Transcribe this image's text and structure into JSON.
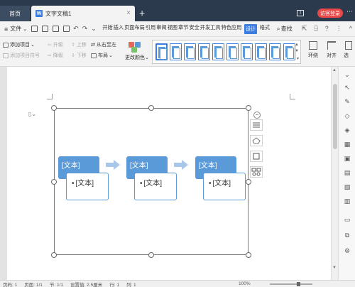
{
  "titlebar": {
    "home_tab": "首页",
    "doc_tab": "文字文稿1",
    "doc_icon": "W",
    "close": "×",
    "new_tab": "+",
    "window_badge": "1",
    "login_label": "访客登录"
  },
  "menubar": {
    "hamburger": "≡",
    "file": "文件",
    "file_arrow": "⌄",
    "items": [
      "开始",
      "插入",
      "页面布局",
      "引用",
      "审阅",
      "视图",
      "章节",
      "安全",
      "开发工具",
      "特色应用"
    ],
    "active_item": "设计",
    "format_item": "格式",
    "search_label": "查找",
    "right": [
      "⇱",
      "⍈",
      "?",
      "⋮",
      "^"
    ]
  },
  "ribbon": {
    "add_item": "添加项目",
    "promote": "升级",
    "move_up": "上移",
    "right_to_left": "从右至左",
    "add_bullet": "添加项目符号",
    "demote": "降级",
    "move_down": "下移",
    "layout": "布局",
    "change_color": "更改颜色",
    "wrap": "环绕",
    "align": "对齐",
    "select": "选"
  },
  "colors": {
    "accent": "#3b7de0",
    "node": "#5b9ad8",
    "arrow": "#a9c7e8",
    "titlebar": "#2b3a4d"
  },
  "smartart": {
    "nodes": [
      {
        "title": "[文本]",
        "bullet": "•",
        "text": "[文本]"
      },
      {
        "title": "[文本]",
        "bullet": "•",
        "text": "[文本]"
      },
      {
        "title": "[文本]",
        "bullet": "•",
        "text": "[文本]"
      }
    ]
  },
  "float_tools": {
    "collapse": "−"
  },
  "statusbar": {
    "page": "页码: 1",
    "pages": "页面: 1/1",
    "section": "节: 1/1",
    "setting": "设置值: 2.5厘米",
    "row": "行: 1",
    "col": "列: 1",
    "zoom": "100%"
  }
}
